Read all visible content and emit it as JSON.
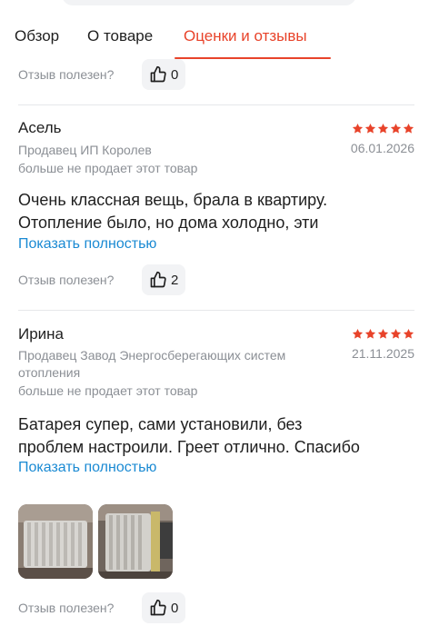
{
  "tabs": {
    "overview": "Обзор",
    "about": "О товаре",
    "reviews": "Оценки и отзывы"
  },
  "helpful_label": "Отзыв полезен?",
  "top_helpful_count": "0",
  "reviews": [
    {
      "author": "Асель",
      "rating": 5,
      "seller": "Продавец ИП Королев",
      "seller_status": "больше не продает этот товар",
      "date": "06.01.2026",
      "text_line1": "Очень классная вещь, брала в квартиру.",
      "text_line2": "Отопление было, но дома холодно, эти",
      "show_more": "Показать полностью",
      "helpful_count": "2"
    },
    {
      "author": "Ирина",
      "rating": 5,
      "seller_line1": "Продавец Завод Энергосберегающих систем",
      "seller_line2": "отопления",
      "seller_status": "больше не продает этот товар",
      "date": "21.11.2025",
      "text_line1": "Батарея супер, сами установили, без",
      "text_line2": "проблем настроили. Греет отлично. Спасибо",
      "show_more": "Показать полностью",
      "helpful_count": "0"
    }
  ],
  "colors": {
    "accent": "#e8432a",
    "link": "#1a8ad3",
    "muted": "#8b8f95",
    "star": "#e8432a"
  },
  "icons": {
    "like": "thumbs-up-icon",
    "star": "star-icon"
  }
}
